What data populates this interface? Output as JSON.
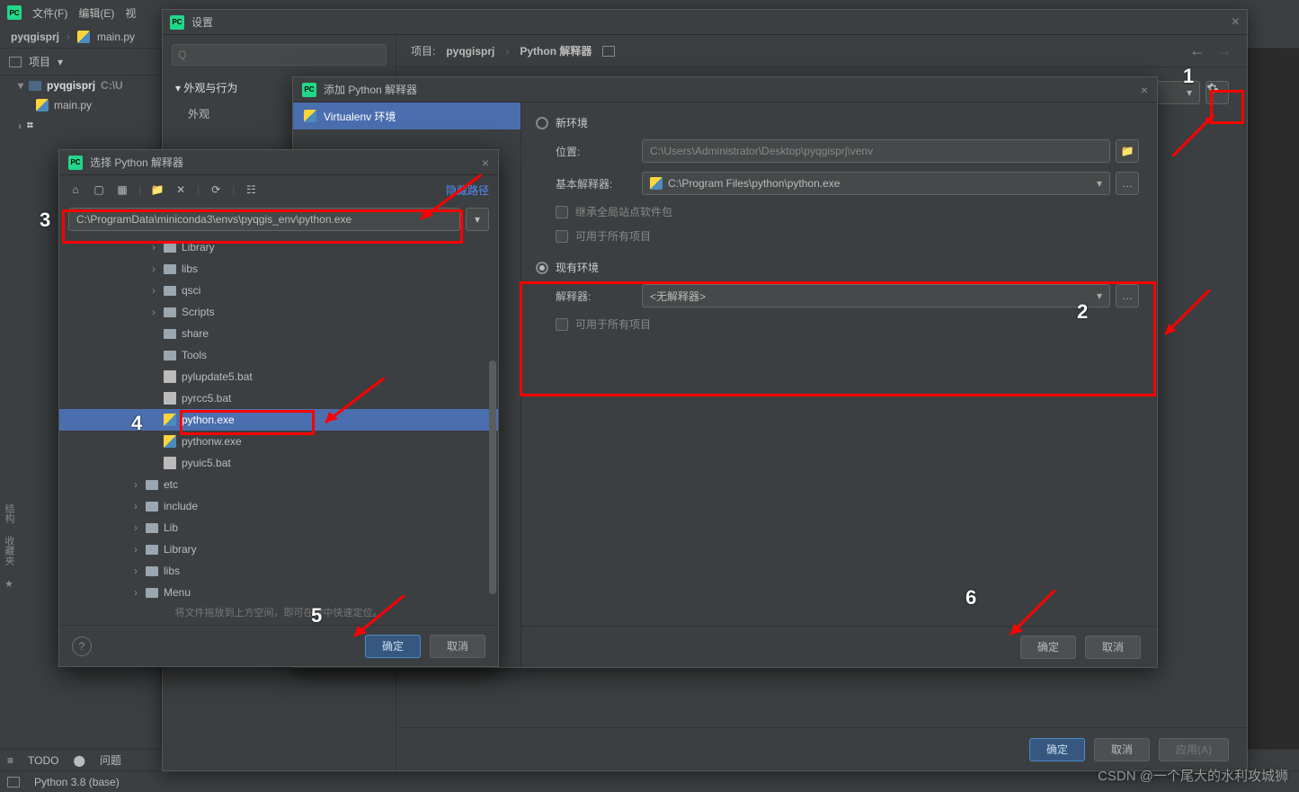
{
  "ide": {
    "menu_file": "文件(F)",
    "menu_edit": "编辑(E)",
    "menu_view": "视",
    "project_name": "pyqgisprj",
    "main_file": "main.py",
    "proj_label": "项目",
    "proj_path_tail": "C:\\U",
    "todo": "TODO",
    "problems": "问题",
    "terminal_label": "Python 3.8 (base)",
    "structure": "结构",
    "favorites": "收藏夹"
  },
  "settings": {
    "title": "设置",
    "search_placeholder": "Q",
    "cat_appearance_behavior": "外观与行为",
    "cat_appearance": "外观",
    "crumb_project": "项目:",
    "crumb_project_name": "pyqgisprj",
    "crumb_interp": "Python 解释器",
    "ok": "确定",
    "cancel": "取消",
    "apply": "应用(A)"
  },
  "addInterp": {
    "title": "添加 Python 解释器",
    "type_virtualenv": "Virtualenv 环境",
    "new_env": "新环境",
    "location_label": "位置:",
    "location_value": "C:\\Users\\Administrator\\Desktop\\pyqgisprj\\venv",
    "base_label": "基本解释器:",
    "base_value": "C:\\Program Files\\python\\python.exe",
    "inherit": "继承全局站点软件包",
    "avail_all": "可用于所有项目",
    "existing_env": "现有环境",
    "interp_label": "解释器:",
    "interp_value": "<无解释器>",
    "avail_all2": "可用于所有项目",
    "ok": "确定",
    "cancel": "取消"
  },
  "fileDlg": {
    "title": "选择 Python 解释器",
    "hide_path": "隐藏路径",
    "path": "C:\\ProgramData\\miniconda3\\envs\\pyqgis_env\\python.exe",
    "hint": "将文件拖放到上方空间，即可在树中快速定位。",
    "ok": "确定",
    "cancel": "取消",
    "tree": [
      {
        "name": "Library",
        "type": "dir",
        "indent": 3,
        "arrow": "›"
      },
      {
        "name": "libs",
        "type": "dir",
        "indent": 3,
        "arrow": "›"
      },
      {
        "name": "qsci",
        "type": "dir",
        "indent": 3,
        "arrow": "›"
      },
      {
        "name": "Scripts",
        "type": "dir",
        "indent": 3,
        "arrow": "›"
      },
      {
        "name": "share",
        "type": "dir",
        "indent": 3,
        "arrow": ""
      },
      {
        "name": "Tools",
        "type": "dir",
        "indent": 3,
        "arrow": ""
      },
      {
        "name": "pylupdate5.bat",
        "type": "bat",
        "indent": 3,
        "arrow": ""
      },
      {
        "name": "pyrcc5.bat",
        "type": "bat",
        "indent": 3,
        "arrow": ""
      },
      {
        "name": "python.exe",
        "type": "exe",
        "indent": 3,
        "arrow": "",
        "selected": true
      },
      {
        "name": "pythonw.exe",
        "type": "exe",
        "indent": 3,
        "arrow": ""
      },
      {
        "name": "pyuic5.bat",
        "type": "bat",
        "indent": 3,
        "arrow": ""
      },
      {
        "name": "etc",
        "type": "dir",
        "indent": 2,
        "arrow": "›"
      },
      {
        "name": "include",
        "type": "dir",
        "indent": 2,
        "arrow": "›"
      },
      {
        "name": "Lib",
        "type": "dir",
        "indent": 2,
        "arrow": "›"
      },
      {
        "name": "Library",
        "type": "dir",
        "indent": 2,
        "arrow": "›"
      },
      {
        "name": "libs",
        "type": "dir",
        "indent": 2,
        "arrow": "›"
      },
      {
        "name": "Menu",
        "type": "dir",
        "indent": 2,
        "arrow": "›"
      }
    ]
  },
  "anno": {
    "n1": "1",
    "n2": "2",
    "n3": "3",
    "n4": "4",
    "n5": "5",
    "n6": "6"
  },
  "watermark": "CSDN @一个尾大的水利攻城狮"
}
